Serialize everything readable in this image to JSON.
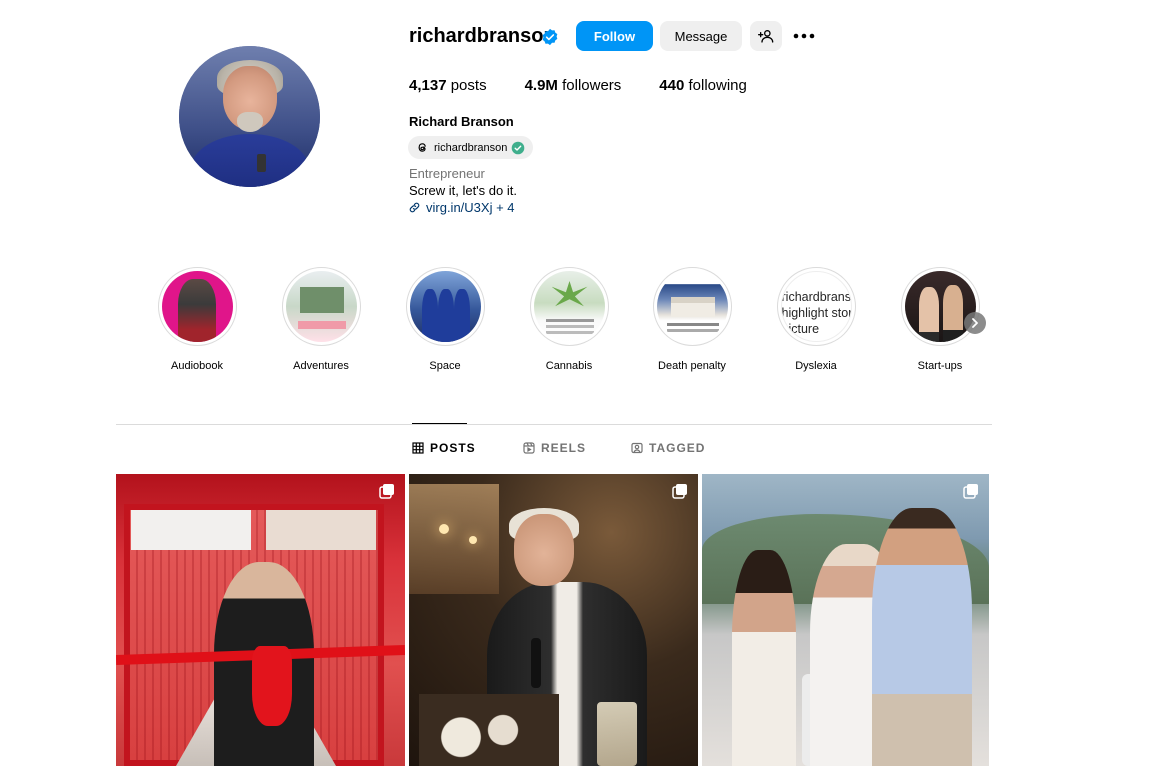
{
  "profile": {
    "username": "richardbranson",
    "full_name": "Richard Branson",
    "threads_handle": "richardbranson",
    "category": "Entrepreneur",
    "bio": "Screw it, let's do it.",
    "link": "virg.in/U3Xj + 4",
    "verified": true
  },
  "actions": {
    "follow_label": "Follow",
    "message_label": "Message"
  },
  "stats": {
    "posts_count": "4,137",
    "posts_label": "posts",
    "followers_count": "4.9M",
    "followers_label": "followers",
    "following_count": "440",
    "following_label": "following"
  },
  "highlights": [
    {
      "label": "Audiobook"
    },
    {
      "label": "Adventures"
    },
    {
      "label": "Space"
    },
    {
      "label": "Cannabis"
    },
    {
      "label": "Death penalty"
    },
    {
      "label": "Dyslexia",
      "alt_text": "richardbranson's highlight story picture"
    },
    {
      "label": "Start-ups"
    }
  ],
  "tabs": [
    {
      "label": "POSTS",
      "active": true
    },
    {
      "label": "REELS",
      "active": false
    },
    {
      "label": "TAGGED",
      "active": false
    }
  ],
  "colors": {
    "accent": "#0095f6",
    "verified_badge": "#0095f6",
    "link": "#00376b",
    "secondary_text": "#737373"
  }
}
